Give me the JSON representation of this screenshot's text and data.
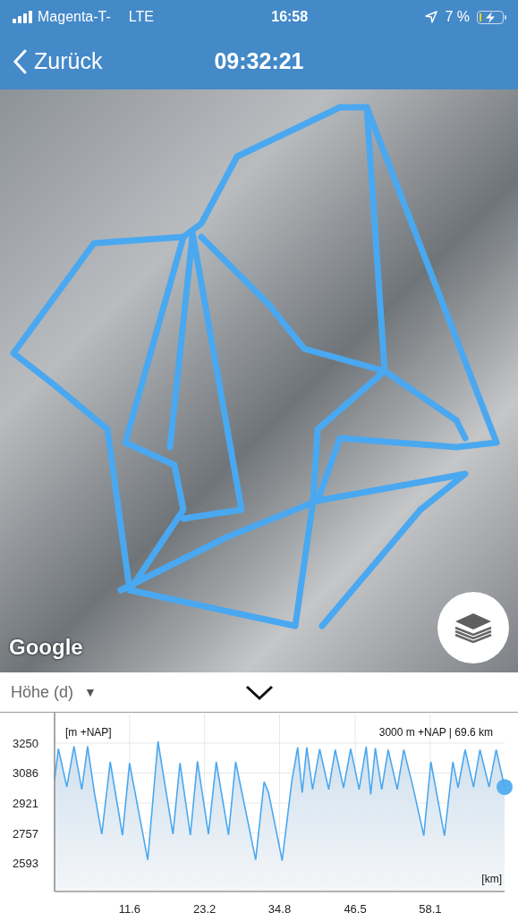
{
  "status_bar": {
    "carrier": "Magenta-T-",
    "network": "LTE",
    "time": "16:58",
    "battery": "7 %"
  },
  "nav_bar": {
    "back": "Zurück",
    "title": "09:32:21"
  },
  "map": {
    "attribution": "Google"
  },
  "chart_panel": {
    "selector": "Höhe (d)",
    "selector_arrow": "▼",
    "chart_data": {
      "type": "area",
      "ylabel": "[m +NAP]",
      "xlabel": "[km]",
      "annotations": [
        "3000 m +NAP | 69.6 km"
      ],
      "xlim": [
        0,
        69.6
      ],
      "ylim": [
        2436,
        3412
      ],
      "xticks": [
        11.6,
        23.2,
        34.8,
        46.5,
        58.1
      ],
      "yticks": [
        2593,
        2757,
        2921,
        3086,
        3250
      ],
      "x": [
        0,
        0.6,
        1.9,
        3.0,
        4.2,
        5.1,
        6.2,
        7.3,
        8.6,
        10.5,
        11.6,
        14.4,
        16.0,
        18.3,
        19.4,
        21.0,
        22.1,
        23.8,
        25.0,
        26.9,
        28.0,
        31.1,
        32.4,
        33.1,
        35.2,
        36.7,
        37.6,
        38.3,
        39.0,
        39.9,
        41.0,
        42.4,
        43.4,
        44.7,
        45.8,
        47.1,
        48.2,
        48.9,
        49.6,
        50.6,
        51.6,
        53.0,
        54.0,
        55.4,
        57.1,
        58.2,
        60.3,
        61.6,
        62.4,
        63.5,
        64.8,
        65.8,
        67.2,
        68.3,
        69.6
      ],
      "grid": true,
      "values": [
        3050,
        3219,
        3009,
        3232,
        2996,
        3232,
        2969,
        2751,
        3147,
        2745,
        3141,
        2609,
        3259,
        2751,
        3141,
        2745,
        3150,
        2751,
        3147,
        2747,
        3147,
        2609,
        3038,
        2978,
        2606,
        3041,
        3226,
        2978,
        3226,
        2996,
        3217,
        2996,
        3214,
        3005,
        3219,
        2996,
        3230,
        2969,
        3223,
        2996,
        3214,
        2996,
        3214,
        3014,
        2742,
        3147,
        2742,
        3147,
        3005,
        3214,
        3009,
        3214,
        3009,
        3214,
        3009
      ]
    }
  }
}
